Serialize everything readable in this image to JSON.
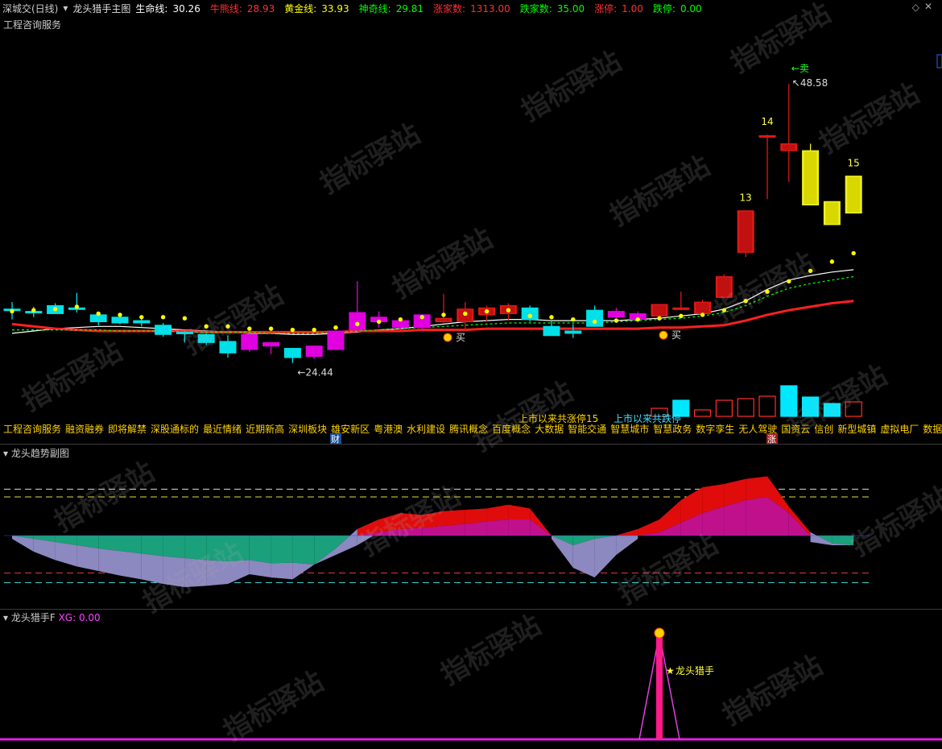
{
  "header": {
    "exchange": "深城交(日线)",
    "indicator_name": "龙头猎手主图",
    "items": [
      {
        "label": "生命线:",
        "value": "30.26",
        "color": "#ffffff"
      },
      {
        "label": "牛熊线:",
        "value": "28.93",
        "color": "#ff3030"
      },
      {
        "label": "黄金线:",
        "value": "33.93",
        "color": "#ffff00"
      },
      {
        "label": "神奇线:",
        "value": "29.81",
        "color": "#00ff00"
      },
      {
        "label": "涨家数:",
        "value": "1313.00",
        "color": "#ff3030"
      },
      {
        "label": "跌家数:",
        "value": "35.00",
        "color": "#00ff00"
      },
      {
        "label": "涨停:",
        "value": "1.00",
        "color": "#ff3030"
      },
      {
        "label": "跌停:",
        "value": "0.00",
        "color": "#00ff00"
      }
    ]
  },
  "main_panel": {
    "subtitle": "工程咨询服务",
    "concepts": [
      "工程咨询服务",
      "融资融券",
      "即将解禁",
      "深股通标的",
      "最近情绪",
      "近期新高",
      "深圳板块",
      "雄安新区",
      "粤港澳",
      "水利建设",
      "腾讯概念",
      "百度概念",
      "大数据",
      "智能交通",
      "智慧城市",
      "智慧政务",
      "数字孪生",
      "无人驾驶",
      "国资云",
      "信创",
      "新型城镇",
      "虚拟电厂",
      "数据确权",
      "数"
    ],
    "buy_label": "买",
    "sell_label": "←卖",
    "high_label": "48.58",
    "low_label": "←24.44",
    "limit_up_text": "上市以来共涨停15",
    "limit_down_text": "上市以来共跌停",
    "cai_label": "财",
    "zhang_label": "涨"
  },
  "sub_panel_1": {
    "title": "龙头趋势副图"
  },
  "sub_panel_2": {
    "title": "龙头猎手F",
    "xg_label": "XG: 0.00",
    "signal_label": "龙头猎手"
  },
  "watermark": "指标驿站",
  "chart_data": [
    {
      "type": "candlestick",
      "title": "龙头猎手主图",
      "ylim": [
        21,
        52
      ],
      "candles": [
        {
          "o": 29.0,
          "h": 29.7,
          "l": 28.2,
          "c": 29.1
        },
        {
          "o": 28.9,
          "h": 29.3,
          "l": 28.4,
          "c": 28.8
        },
        {
          "o": 28.7,
          "h": 29.6,
          "l": 28.7,
          "c": 29.4
        },
        {
          "o": 29.2,
          "h": 30.5,
          "l": 28.8,
          "c": 29.1
        },
        {
          "o": 28.6,
          "h": 28.8,
          "l": 27.7,
          "c": 28.0
        },
        {
          "o": 28.4,
          "h": 28.5,
          "l": 27.8,
          "c": 27.9
        },
        {
          "o": 28.1,
          "h": 28.5,
          "l": 27.6,
          "c": 27.9
        },
        {
          "o": 27.7,
          "h": 27.9,
          "l": 26.7,
          "c": 26.9
        },
        {
          "o": 27.0,
          "h": 27.2,
          "l": 26.2,
          "c": 27.1
        },
        {
          "o": 26.9,
          "h": 27.0,
          "l": 26.0,
          "c": 26.2
        },
        {
          "o": 26.3,
          "h": 26.8,
          "l": 24.9,
          "c": 25.3
        },
        {
          "o": 25.6,
          "h": 26.9,
          "l": 25.4,
          "c": 26.9
        },
        {
          "o": 25.9,
          "h": 26.1,
          "l": 25.2,
          "c": 26.2
        },
        {
          "o": 24.9,
          "h": 25.6,
          "l": 24.44,
          "c": 25.7
        },
        {
          "o": 25.0,
          "h": 25.8,
          "l": 24.8,
          "c": 25.9
        },
        {
          "o": 25.6,
          "h": 27.2,
          "l": 25.6,
          "c": 27.2
        },
        {
          "o": 27.3,
          "h": 31.5,
          "l": 27.2,
          "c": 28.8
        },
        {
          "o": 28.0,
          "h": 28.9,
          "l": 27.5,
          "c": 28.4
        },
        {
          "o": 27.5,
          "h": 28.1,
          "l": 27.3,
          "c": 28.1
        },
        {
          "o": 27.5,
          "h": 28.6,
          "l": 27.2,
          "c": 28.6
        },
        {
          "o": 28.0,
          "h": 30.4,
          "l": 27.9,
          "c": 28.3
        },
        {
          "o": 28.0,
          "h": 29.7,
          "l": 27.2,
          "c": 29.1
        },
        {
          "o": 28.6,
          "h": 29.4,
          "l": 28.0,
          "c": 29.2
        },
        {
          "o": 28.7,
          "h": 29.6,
          "l": 28.1,
          "c": 29.4
        },
        {
          "o": 29.2,
          "h": 29.4,
          "l": 28.0,
          "c": 28.2
        },
        {
          "o": 27.6,
          "h": 28.1,
          "l": 26.8,
          "c": 26.8
        },
        {
          "o": 27.2,
          "h": 27.8,
          "l": 26.6,
          "c": 27.0
        },
        {
          "o": 29.0,
          "h": 29.4,
          "l": 27.6,
          "c": 27.6
        },
        {
          "o": 28.4,
          "h": 29.2,
          "l": 28.3,
          "c": 28.9
        },
        {
          "o": 28.2,
          "h": 28.9,
          "l": 28.0,
          "c": 28.7
        },
        {
          "o": 28.5,
          "h": 29.3,
          "l": 28.1,
          "c": 29.5
        },
        {
          "o": 29.1,
          "h": 30.6,
          "l": 29.0,
          "c": 29.2
        },
        {
          "o": 28.7,
          "h": 29.9,
          "l": 28.5,
          "c": 29.7
        },
        {
          "o": 30.1,
          "h": 32.1,
          "l": 30.0,
          "c": 31.9
        },
        {
          "o": 34.0,
          "h": 37.6,
          "l": 33.6,
          "c": 37.6
        },
        {
          "o": 44.1,
          "h": 44.2,
          "l": 38.6,
          "c": 44.1
        },
        {
          "o": 42.8,
          "h": 48.58,
          "l": 40.1,
          "c": 43.4
        },
        {
          "o": 42.8,
          "h": 43.4,
          "l": 38.1,
          "c": 38.1
        },
        {
          "o": 36.4,
          "h": 38.4,
          "l": 36.4,
          "c": 38.4
        },
        {
          "o": 37.4,
          "h": 40.6,
          "l": 37.4,
          "c": 40.6
        }
      ],
      "candle_colors": [
        "cyan",
        "cyan",
        "cyan",
        "cyan",
        "cyan",
        "cyan",
        "cyan",
        "cyan",
        "cyan",
        "cyan",
        "cyan",
        "magenta",
        "magenta",
        "cyan",
        "magenta",
        "magenta",
        "magenta",
        "magenta",
        "magenta",
        "magenta",
        "red",
        "red",
        "red",
        "red",
        "cyan",
        "cyan",
        "cyan",
        "cyan",
        "magenta",
        "magenta",
        "red",
        "red",
        "red",
        "red",
        "red",
        "red",
        "red",
        "yellow",
        "yellow",
        "yellow"
      ],
      "candle_labels": [
        {
          "index": 34,
          "text": "13"
        },
        {
          "index": 35,
          "text": "14"
        },
        {
          "index": 39,
          "text": "15"
        }
      ],
      "lines": [
        {
          "name": "生命线",
          "color": "#ffffff",
          "values": [
            27.0,
            27.2,
            27.4,
            27.5,
            27.6,
            27.6,
            27.5,
            27.4,
            27.3,
            27.2,
            27.1,
            27.0,
            27.0,
            26.9,
            26.9,
            27.0,
            27.1,
            27.3,
            27.4,
            27.6,
            27.8,
            28.0,
            28.1,
            28.2,
            28.2,
            28.1,
            28.1,
            28.1,
            28.1,
            28.2,
            28.3,
            28.5,
            28.7,
            29.1,
            29.8,
            30.8,
            31.6,
            32.0,
            32.3,
            32.5
          ]
        },
        {
          "name": "牛熊线",
          "color": "#ff2020",
          "values": [
            27.8,
            27.6,
            27.4,
            27.3,
            27.2,
            27.2,
            27.2,
            27.2,
            27.2,
            27.1,
            27.1,
            27.1,
            27.1,
            27.1,
            27.1,
            27.1,
            27.2,
            27.2,
            27.2,
            27.3,
            27.3,
            27.3,
            27.4,
            27.4,
            27.4,
            27.4,
            27.4,
            27.4,
            27.4,
            27.4,
            27.5,
            27.5,
            27.6,
            27.7,
            28.1,
            28.6,
            29.0,
            29.3,
            29.6,
            29.8
          ]
        },
        {
          "name": "神奇线",
          "color": "#00ff00",
          "values": [
            27.3,
            27.3,
            27.3,
            27.3,
            27.3,
            27.2,
            27.2,
            27.2,
            27.1,
            27.1,
            27.1,
            27.1,
            27.0,
            27.0,
            27.0,
            27.1,
            27.2,
            27.3,
            27.4,
            27.5,
            27.6,
            27.7,
            27.8,
            27.9,
            27.9,
            27.9,
            27.9,
            27.9,
            28.0,
            28.1,
            28.2,
            28.3,
            28.5,
            28.8,
            29.4,
            30.2,
            30.9,
            31.3,
            31.6,
            31.9
          ]
        }
      ],
      "dots": {
        "name": "黄金线",
        "color": "#ffff00",
        "values": [
          28.9,
          29.0,
          29.1,
          29.3,
          28.7,
          28.6,
          28.4,
          28.4,
          28.3,
          27.6,
          27.6,
          27.4,
          27.4,
          27.3,
          27.3,
          27.5,
          27.8,
          28.0,
          28.2,
          28.4,
          28.6,
          28.7,
          28.9,
          29.0,
          28.5,
          28.4,
          28.2,
          28.0,
          28.1,
          28.2,
          28.3,
          28.5,
          28.6,
          29.0,
          29.8,
          30.6,
          31.5,
          32.4,
          33.2,
          33.93
        ]
      },
      "markers": [
        {
          "index": 20,
          "label": "买"
        },
        {
          "index": 30,
          "label": "买"
        },
        {
          "index": 36,
          "label": "←卖"
        }
      ],
      "volume_bars": [
        {
          "index": 30,
          "h": 10,
          "color": "#ff3030",
          "filled": false
        },
        {
          "index": 31,
          "h": 20,
          "color": "#00e8ff",
          "filled": true
        },
        {
          "index": 32,
          "h": 8,
          "color": "#ff3030",
          "filled": false
        },
        {
          "index": 33,
          "h": 20,
          "color": "#ff3030",
          "filled": false
        },
        {
          "index": 34,
          "h": 22,
          "color": "#ff3030",
          "filled": false
        },
        {
          "index": 35,
          "h": 25,
          "color": "#ff3030",
          "filled": false
        },
        {
          "index": 36,
          "h": 38,
          "color": "#00e8ff",
          "filled": true
        },
        {
          "index": 37,
          "h": 24,
          "color": "#00e8ff",
          "filled": true
        },
        {
          "index": 38,
          "h": 16,
          "color": "#00e8ff",
          "filled": true
        },
        {
          "index": 39,
          "h": 18,
          "color": "#ff3030",
          "filled": false
        }
      ]
    },
    {
      "type": "area",
      "title": "龙头趋势副图",
      "ylim": [
        -100,
        100
      ],
      "baseline": 0,
      "upper_lines": [
        72,
        60
      ],
      "lower_lines": [
        -58,
        -73
      ],
      "series": [
        {
          "name": "upper",
          "values": [
            0,
            -5,
            -10,
            -15,
            -20,
            -24,
            -28,
            -32,
            -35,
            -38,
            -40,
            -38,
            -43,
            -42,
            -45,
            -20,
            10,
            25,
            35,
            32,
            38,
            40,
            42,
            48,
            42,
            0,
            -15,
            -5,
            0,
            10,
            25,
            55,
            75,
            80,
            88,
            92,
            45,
            5,
            -12,
            -15
          ]
        },
        {
          "name": "lower",
          "values": [
            -5,
            -25,
            -38,
            -48,
            -55,
            -62,
            -68,
            -75,
            -80,
            -78,
            -75,
            -60,
            -65,
            -68,
            -45,
            -30,
            -15,
            5,
            10,
            12,
            15,
            18,
            22,
            25,
            25,
            -5,
            -50,
            -65,
            -30,
            -5,
            5,
            20,
            35,
            45,
            55,
            60,
            35,
            -10,
            -15,
            -15
          ]
        }
      ]
    },
    {
      "type": "line",
      "title": "龙头猎手F",
      "series": [
        {
          "name": "XG",
          "values": [
            0,
            0,
            0,
            0,
            0,
            0,
            0,
            0,
            0,
            0,
            0,
            0,
            0,
            0,
            0,
            0,
            0,
            0,
            0,
            0,
            0,
            0,
            0,
            0,
            0,
            0,
            0,
            0,
            0,
            0,
            1,
            0,
            0,
            0,
            0,
            0,
            0,
            0,
            0,
            0
          ]
        }
      ]
    }
  ]
}
